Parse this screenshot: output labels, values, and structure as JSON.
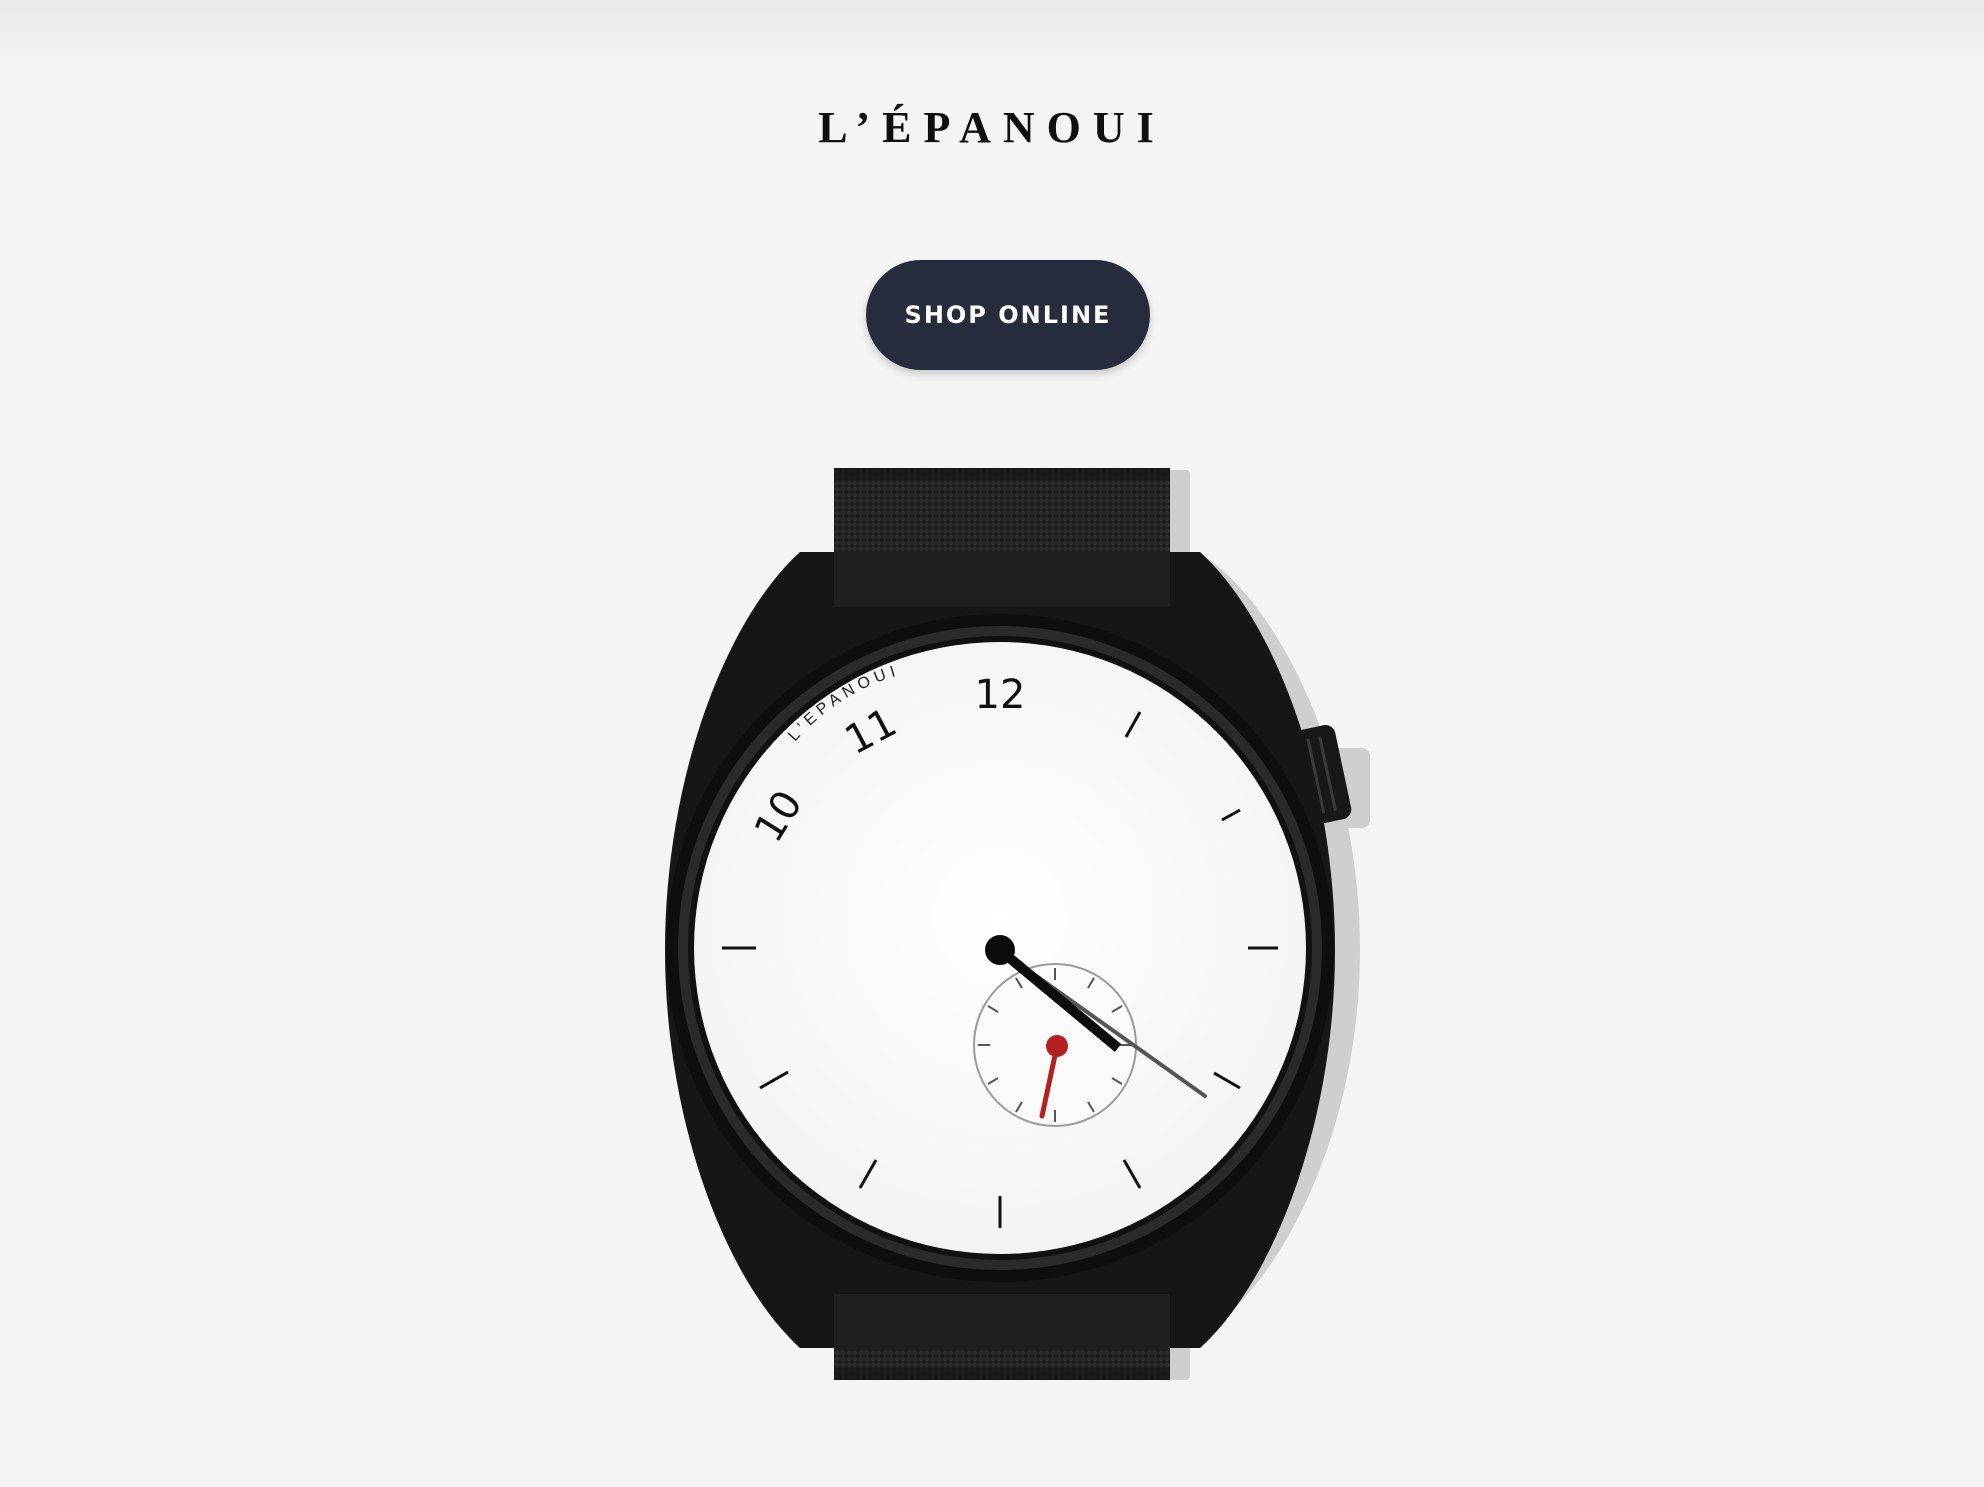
{
  "header": {
    "brand": "L’ÉPANOUI"
  },
  "hero": {
    "shop_button_label": "SHOP ONLINE"
  },
  "watch": {
    "dial_brand": "L’EPANOUI",
    "numerals": [
      "10",
      "11",
      "12"
    ],
    "colors": {
      "case": "#121212",
      "dial": "#ffffff",
      "strap": "#1a1a1a",
      "seconds_hand": "#b3201f",
      "button": "#272c3d"
    }
  }
}
